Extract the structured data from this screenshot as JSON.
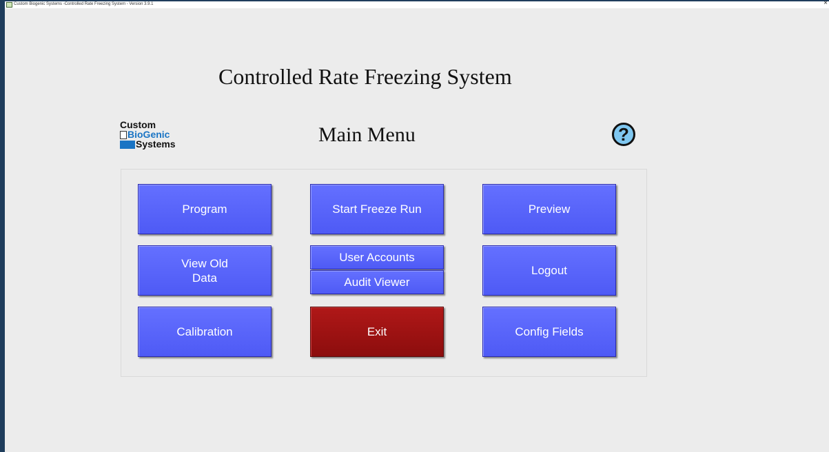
{
  "window": {
    "title": "Custom Biogenic Systems -Controlled Rate Freezing System - Version 3.9.1",
    "close_glyph": "×"
  },
  "header": {
    "title": "Controlled Rate Freezing System",
    "subtitle": "Main Menu"
  },
  "logo": {
    "line1": "Custom",
    "line2": "BioGenic",
    "line3": "Systems",
    "colors": {
      "blue": "#1a74c4",
      "dark": "#111111"
    }
  },
  "help": {
    "icon": "help-icon",
    "glyph": "?"
  },
  "menu": {
    "program": "Program",
    "start_freeze_run": "Start Freeze Run",
    "preview": "Preview",
    "view_old_data": "View Old\nData",
    "user_accounts": "User Accounts",
    "audit_viewer": "Audit Viewer",
    "logout": "Logout",
    "calibration": "Calibration",
    "exit": "Exit",
    "config_fields": "Config Fields"
  },
  "colors": {
    "button_blue": "#5560fa",
    "button_red": "#9e1212",
    "background": "#ececec",
    "window_border": "#1f3d5c"
  }
}
